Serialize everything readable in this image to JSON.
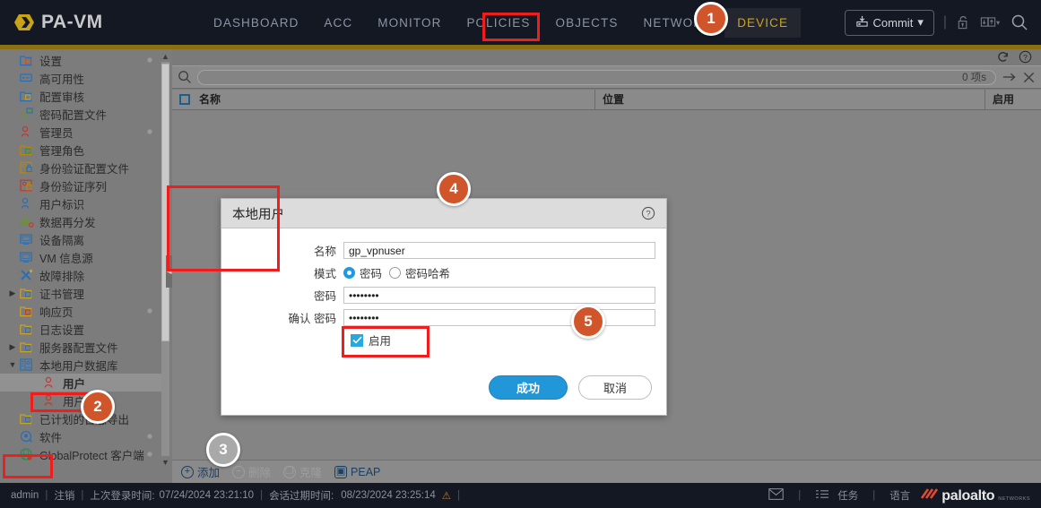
{
  "topnav": {
    "brand": "PA-VM",
    "items": [
      {
        "label": "DASHBOARD",
        "active": false
      },
      {
        "label": "ACC",
        "active": false
      },
      {
        "label": "MONITOR",
        "active": false
      },
      {
        "label": "POLICIES",
        "active": false
      },
      {
        "label": "OBJECTS",
        "active": false
      },
      {
        "label": "NETWORK",
        "active": false
      },
      {
        "label": "DEVICE",
        "active": true
      }
    ],
    "commit_label": "Commit",
    "icons": [
      "lock-icon",
      "config-transfer-icon",
      "search-icon"
    ]
  },
  "sidebar": {
    "items": [
      {
        "label": "设置",
        "icon": "settings-icon",
        "indent": 1,
        "twisty": "",
        "dot": true
      },
      {
        "label": "高可用性",
        "icon": "high-availability-icon",
        "indent": 1,
        "twisty": "",
        "dot": false
      },
      {
        "label": "配置审核",
        "icon": "config-audit-icon",
        "indent": 1,
        "twisty": "",
        "dot": false
      },
      {
        "label": "密码配置文件",
        "icon": "key-icon",
        "indent": 1,
        "twisty": "",
        "dot": false
      },
      {
        "label": "管理员",
        "icon": "administrator-icon",
        "indent": 1,
        "twisty": "",
        "dot": true
      },
      {
        "label": "管理角色",
        "icon": "admin-roles-icon",
        "indent": 1,
        "twisty": "",
        "dot": false
      },
      {
        "label": "身份验证配置文件",
        "icon": "auth-profile-icon",
        "indent": 1,
        "twisty": "",
        "dot": false
      },
      {
        "label": "身份验证序列",
        "icon": "auth-sequence-icon",
        "indent": 1,
        "twisty": "",
        "dot": false
      },
      {
        "label": "用户标识",
        "icon": "user-identification-icon",
        "indent": 1,
        "twisty": "",
        "dot": false
      },
      {
        "label": "数据再分发",
        "icon": "data-redistribution-icon",
        "indent": 1,
        "twisty": "",
        "dot": false
      },
      {
        "label": "设备隔离",
        "icon": "device-quarantine-icon",
        "indent": 1,
        "twisty": "",
        "dot": false
      },
      {
        "label": "VM 信息源",
        "icon": "vm-information-sources-icon",
        "indent": 1,
        "twisty": "",
        "dot": false
      },
      {
        "label": "故障排除",
        "icon": "troubleshooting-icon",
        "indent": 1,
        "twisty": "",
        "dot": false
      },
      {
        "label": "证书管理",
        "icon": "certificate-management-icon",
        "indent": 1,
        "twisty": "▶",
        "dot": false
      },
      {
        "label": "响应页",
        "icon": "response-pages-icon",
        "indent": 1,
        "twisty": "",
        "dot": true
      },
      {
        "label": "日志设置",
        "icon": "log-settings-icon",
        "indent": 1,
        "twisty": "",
        "dot": false
      },
      {
        "label": "服务器配置文件",
        "icon": "server-profiles-icon",
        "indent": 1,
        "twisty": "▶",
        "dot": false
      },
      {
        "label": "本地用户数据库",
        "icon": "local-user-database-icon",
        "indent": 1,
        "twisty": "▼",
        "dot": false
      },
      {
        "label": "用户",
        "icon": "users-icon",
        "indent": 2,
        "twisty": "",
        "dot": false,
        "selected": true
      },
      {
        "label": "用户组",
        "icon": "user-groups-icon",
        "indent": 2,
        "twisty": "",
        "dot": false
      },
      {
        "label": "已计划的日志导出",
        "icon": "scheduled-log-export-icon",
        "indent": 1,
        "twisty": "",
        "dot": false
      },
      {
        "label": "软件",
        "icon": "software-icon",
        "indent": 1,
        "twisty": "",
        "dot": true
      },
      {
        "label": "GlobalProtect 客户端",
        "icon": "globalprotect-client-icon",
        "indent": 1,
        "twisty": "",
        "dot": true
      }
    ]
  },
  "panel": {
    "refresh_icon": "refresh-icon",
    "help_icon": "help-icon",
    "search_placeholder": "",
    "search_value": "",
    "item_count": "0 项s",
    "arrow_icon": "arrow-right-icon",
    "clear_icon": "close-icon",
    "columns": [
      "名称",
      "位置",
      "启用"
    ],
    "rows": [],
    "bottom_buttons": [
      {
        "label": "添加",
        "icon": "plus-circle-icon",
        "enabled": true
      },
      {
        "label": "删除",
        "icon": "minus-circle-icon",
        "enabled": false
      },
      {
        "label": "克隆",
        "icon": "clone-icon",
        "enabled": false
      },
      {
        "label": "PEAP",
        "icon": "peap-icon",
        "enabled": true
      }
    ]
  },
  "dialog": {
    "title": "本地用户",
    "help_icon": "help-icon",
    "fields": {
      "name_label": "名称",
      "name_value": "gp_vpnuser",
      "mode_label": "模式",
      "mode_options": [
        {
          "label": "密码",
          "selected": true
        },
        {
          "label": "密码哈希",
          "selected": false
        }
      ],
      "password_label": "密码",
      "password_value": "••••••••",
      "confirm_label": "确认 密码",
      "confirm_value": "••••••••",
      "enable_label": "启用",
      "enable_checked": true
    },
    "ok_label": "成功",
    "cancel_label": "取消"
  },
  "annotations": {
    "badges": [
      {
        "number": "1",
        "style": "orange"
      },
      {
        "number": "2",
        "style": "orange"
      },
      {
        "number": "3",
        "style": "grey"
      },
      {
        "number": "4",
        "style": "orange"
      },
      {
        "number": "5",
        "style": "orange"
      }
    ],
    "highlight_color": "#f01d1d"
  },
  "statusbar": {
    "user": "admin",
    "logout": "注销",
    "last_login_label": "上次登录时间:",
    "last_login_value": "07/24/2024 23:21:10",
    "session_expire_label": "会话过期时间:",
    "session_expire_value": "08/23/2024 23:25:14",
    "warning_icon": "warning-icon",
    "mail_icon": "mail-icon",
    "tasks_label": "任务",
    "tasks_icon": "tasks-icon",
    "language_label": "语言",
    "brand": "paloalto",
    "brand_sub": "NETWORKS"
  }
}
